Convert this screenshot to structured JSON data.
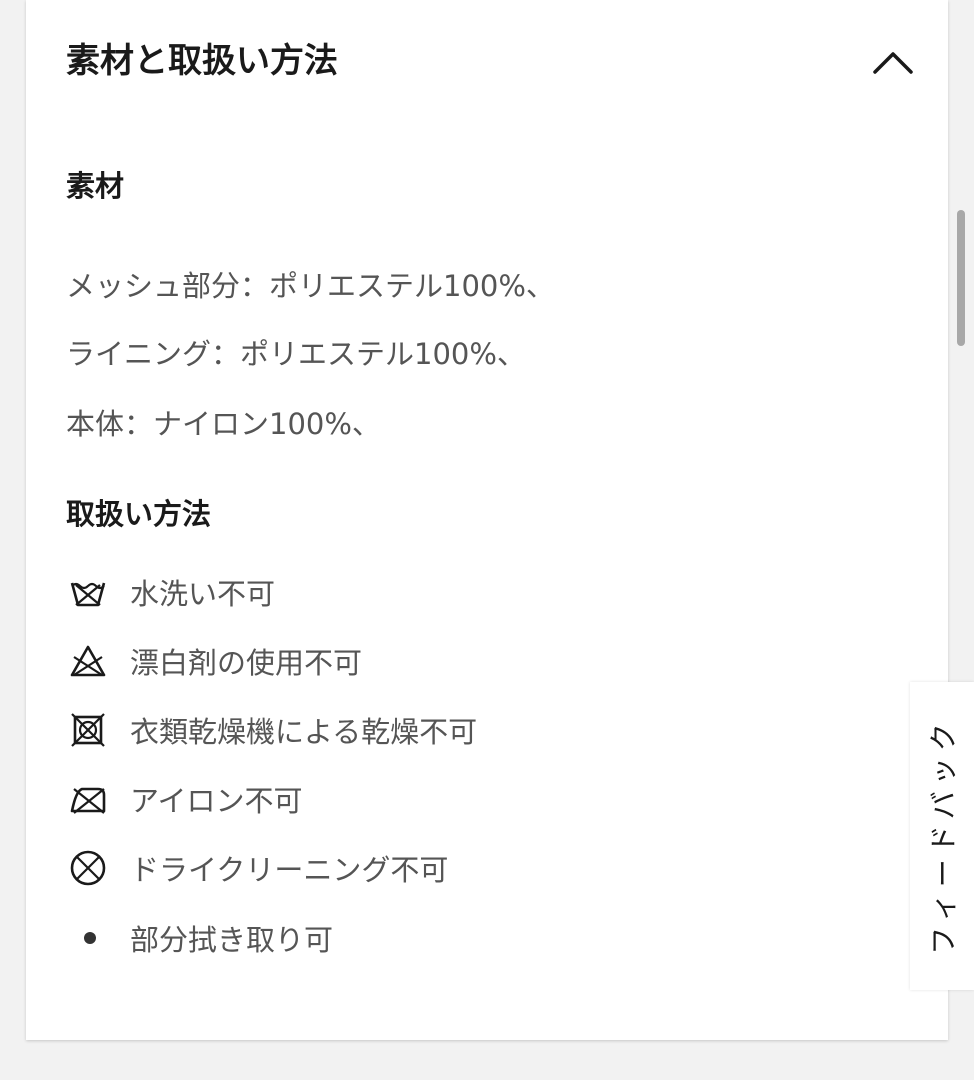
{
  "section": {
    "title": "素材と取扱い方法",
    "toggle_icon": "chevron-up-icon"
  },
  "materials": {
    "heading": "素材",
    "lines": [
      "メッシュ部分：ポリエステル100%、",
      "ライニング：ポリエステル100%、",
      "本体：ナイロン100%、"
    ]
  },
  "care": {
    "heading": "取扱い方法",
    "items": [
      {
        "icon": "no-wash-icon",
        "label": "水洗い不可"
      },
      {
        "icon": "no-bleach-icon",
        "label": "漂白剤の使用不可"
      },
      {
        "icon": "no-tumble-dry-icon",
        "label": "衣類乾燥機による乾燥不可"
      },
      {
        "icon": "no-iron-icon",
        "label": "アイロン不可"
      },
      {
        "icon": "no-dry-clean-icon",
        "label": "ドライクリーニング不可"
      },
      {
        "icon": "bullet-icon",
        "label": "部分拭き取り可"
      }
    ]
  },
  "feedback": {
    "label": "フィードバック"
  },
  "colors": {
    "heading": "#1a1a1a",
    "body_text": "#555555",
    "background": "#f2f2f2",
    "card": "#ffffff"
  }
}
